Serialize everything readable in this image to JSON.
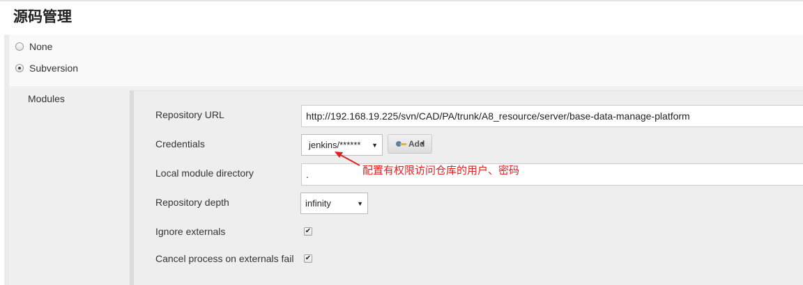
{
  "section": {
    "title": "源码管理"
  },
  "scm_options": [
    {
      "label": "None",
      "checked": false
    },
    {
      "label": "Subversion",
      "checked": true
    }
  ],
  "modules": {
    "label": "Modules",
    "repository_url": {
      "label": "Repository URL",
      "value": "http://192.168.19.225/svn/CAD/PA/trunk/A8_resource/server/base-data-manage-platform"
    },
    "credentials": {
      "label": "Credentials",
      "value": "jenkins/******",
      "add_label": "Add"
    },
    "local_module_directory": {
      "label": "Local module directory",
      "value": "."
    },
    "repository_depth": {
      "label": "Repository depth",
      "value": "infinity"
    },
    "ignore_externals": {
      "label": "Ignore externals",
      "checked": true,
      "mark": "✔"
    },
    "cancel_on_externals_fail": {
      "label": "Cancel process on externals fail",
      "checked": true,
      "mark": "✔"
    }
  },
  "annotation": {
    "text": "配置有权限访问仓库的用户、密码",
    "color": "#e02020"
  },
  "colors": {
    "accent_red": "#e02020",
    "panel": "#eeeeee"
  }
}
